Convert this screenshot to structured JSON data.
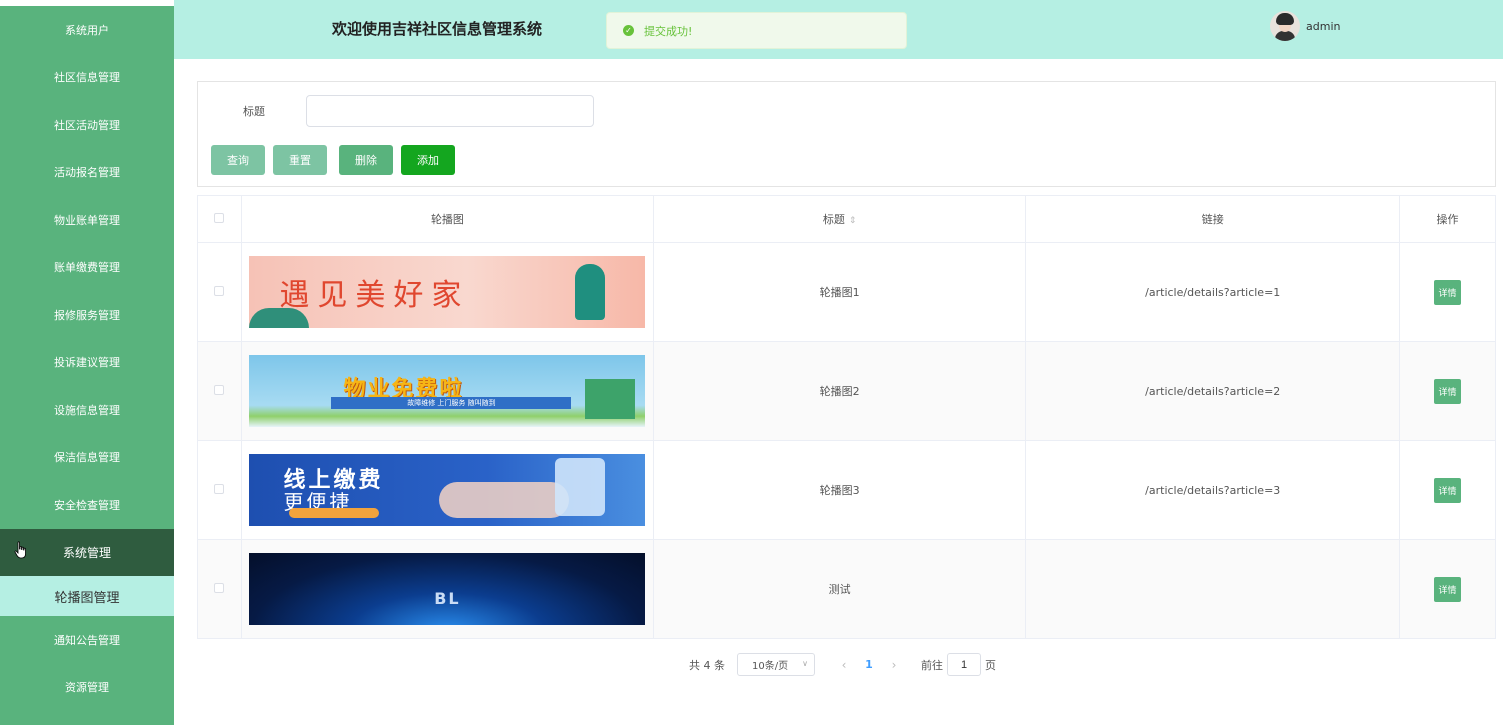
{
  "sidebar": {
    "items": [
      {
        "label": "系统用户"
      },
      {
        "label": "社区信息管理"
      },
      {
        "label": "社区活动管理"
      },
      {
        "label": "活动报名管理"
      },
      {
        "label": "物业账单管理"
      },
      {
        "label": "账单缴费管理"
      },
      {
        "label": "报修服务管理"
      },
      {
        "label": "投诉建议管理"
      },
      {
        "label": "设施信息管理"
      },
      {
        "label": "保洁信息管理"
      },
      {
        "label": "安全检查管理"
      },
      {
        "label": "系统管理"
      }
    ],
    "active_sub": "轮播图管理",
    "after": [
      {
        "label": "通知公告管理"
      },
      {
        "label": "资源管理"
      }
    ]
  },
  "header": {
    "title": "欢迎使用吉祥社区信息管理系统",
    "toast": "提交成功!",
    "username": "admin"
  },
  "search": {
    "title_label": "标题",
    "title_value": "",
    "buttons": {
      "query": "查询",
      "reset": "重置",
      "delete": "删除",
      "add": "添加"
    }
  },
  "table": {
    "columns": [
      "轮播图",
      "标题",
      "链接",
      "操作"
    ],
    "rows": [
      {
        "title": "轮播图1",
        "link": "/article/details?article=1",
        "action": "详情",
        "banner_text": "遇见美好家"
      },
      {
        "title": "轮播图2",
        "link": "/article/details?article=2",
        "action": "详情",
        "banner_text": "物业免费啦",
        "banner_sub": "故障维修  上门服务  随叫随到"
      },
      {
        "title": "轮播图3",
        "link": "/article/details?article=3",
        "action": "详情",
        "banner_text": "线上缴费",
        "banner_text2": "更便捷"
      },
      {
        "title": "测试",
        "link": "",
        "action": "详情",
        "banner_text": "BL"
      }
    ]
  },
  "pagination": {
    "total": "共 4 条",
    "page_size": "10条/页",
    "current": "1",
    "goto_label": "前往",
    "goto_value": "1",
    "page_unit": "页"
  },
  "colors": {
    "sidebar": "#59b37d",
    "header": "#b5efe3",
    "active_parent": "#2f5c3f",
    "success": "#67c23a"
  }
}
